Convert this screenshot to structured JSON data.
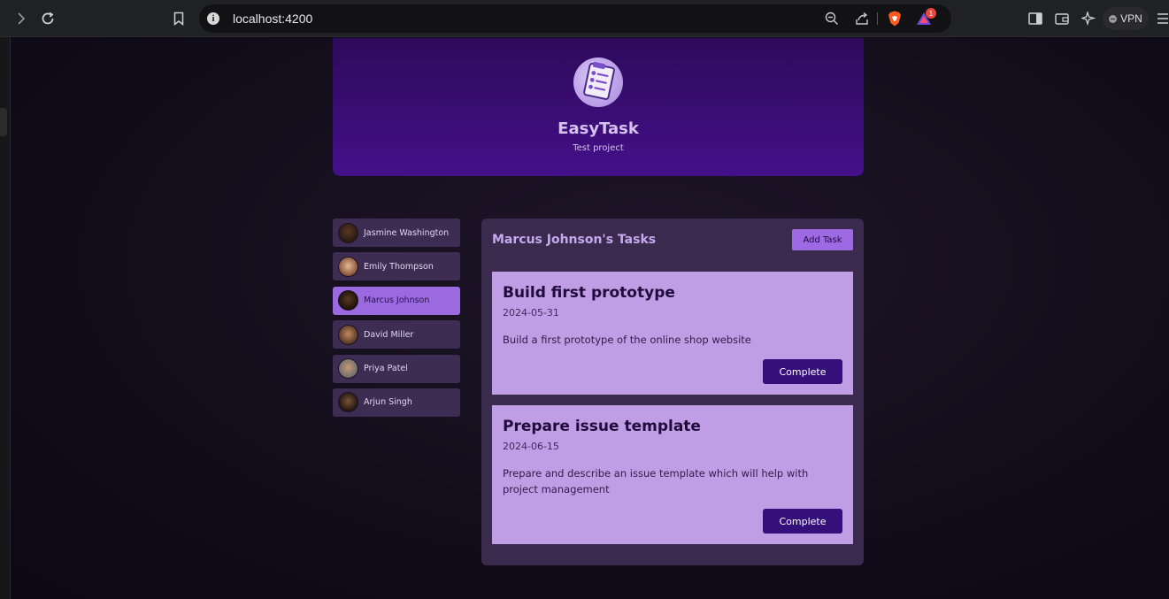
{
  "browser": {
    "url": "localhost:4200",
    "notification_count": "1",
    "vpn_label": "VPN"
  },
  "header": {
    "title": "EasyTask",
    "subtitle": "Test project"
  },
  "users": [
    {
      "name": "Jasmine Washington",
      "active": false,
      "avatar_color": "#4a2e1e"
    },
    {
      "name": "Emily Thompson",
      "active": false,
      "avatar_color": "#c28a6a"
    },
    {
      "name": "Marcus Johnson",
      "active": true,
      "avatar_color": "#3a2416"
    },
    {
      "name": "David Miller",
      "active": false,
      "avatar_color": "#8a5a3e"
    },
    {
      "name": "Priya Patel",
      "active": false,
      "avatar_color": "#a37256"
    },
    {
      "name": "Arjun Singh",
      "active": false,
      "avatar_color": "#5a3a28"
    }
  ],
  "tasks_panel": {
    "title": "Marcus Johnson's Tasks",
    "add_label": "Add Task",
    "tasks": [
      {
        "title": "Build first prototype",
        "date": "2024-05-31",
        "description": "Build a first prototype of the online shop website",
        "button": "Complete"
      },
      {
        "title": "Prepare issue template",
        "date": "2024-06-15",
        "description": "Prepare and describe an issue template which will help with project management",
        "button": "Complete"
      }
    ]
  },
  "colors": {
    "accent": "#9b6ae0",
    "task_card": "#c09ee6",
    "complete_button": "#35107a"
  }
}
